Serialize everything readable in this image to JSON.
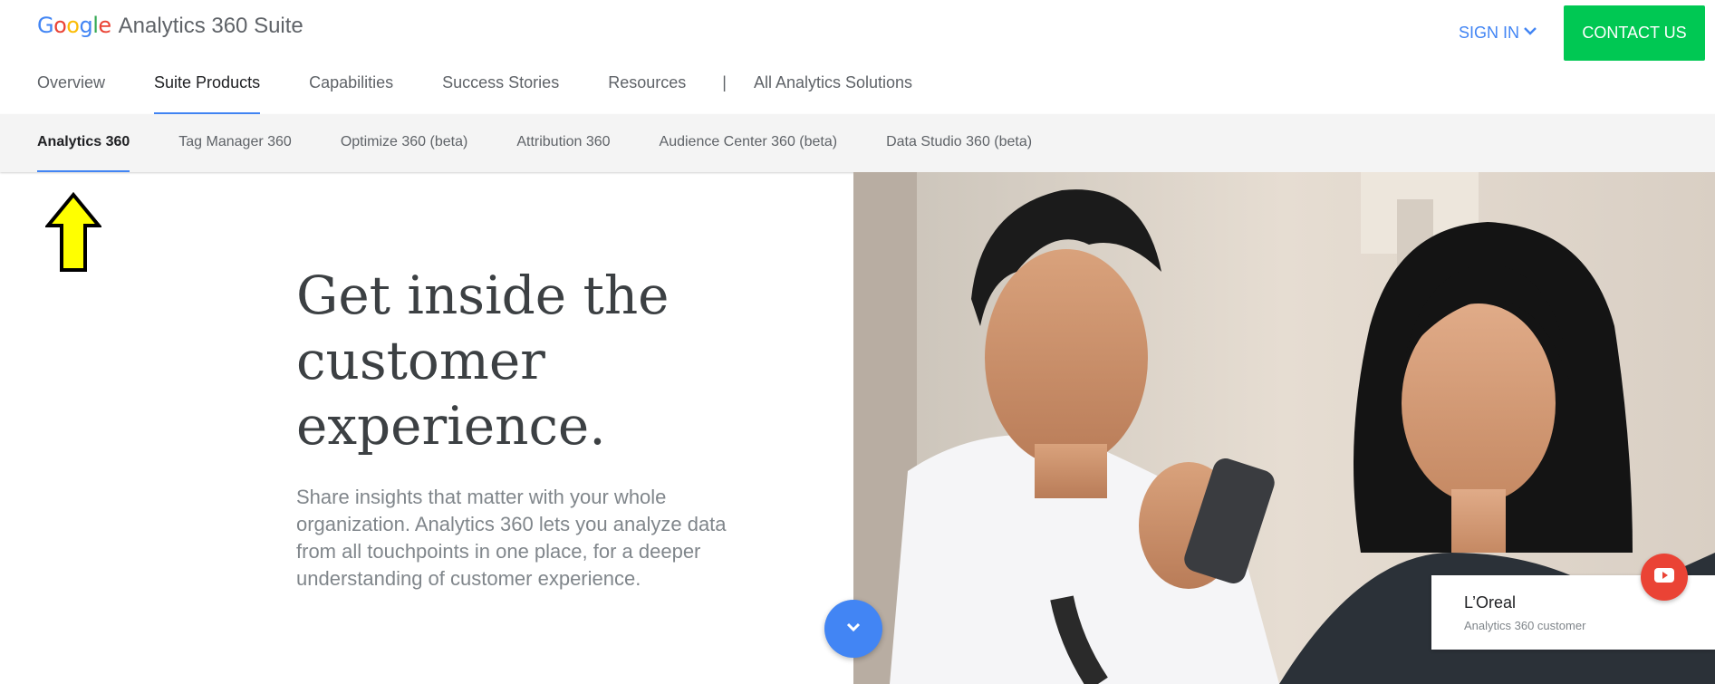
{
  "logo": {
    "google_letters": [
      "G",
      "o",
      "o",
      "g",
      "l",
      "e"
    ],
    "product": "Analytics 360 Suite"
  },
  "header": {
    "sign_in": "SIGN IN",
    "contact": "CONTACT US",
    "nav": [
      {
        "label": "Overview",
        "active": false
      },
      {
        "label": "Suite Products",
        "active": true
      },
      {
        "label": "Capabilities",
        "active": false
      },
      {
        "label": "Success Stories",
        "active": false
      },
      {
        "label": "Resources",
        "active": false
      },
      {
        "label": "All Analytics Solutions",
        "active": false
      }
    ],
    "separator": "|"
  },
  "sub_nav": [
    {
      "label": "Analytics 360",
      "active": true
    },
    {
      "label": "Tag Manager 360",
      "active": false
    },
    {
      "label": "Optimize 360 (beta)",
      "active": false
    },
    {
      "label": "Attribution 360",
      "active": false
    },
    {
      "label": "Audience Center 360 (beta)",
      "active": false
    },
    {
      "label": "Data Studio 360 (beta)",
      "active": false
    }
  ],
  "hero": {
    "headline_lines": [
      "Get inside the",
      "customer",
      "experience."
    ],
    "body": "Share insights that matter with your whole organization. Analytics 360 lets you analyze data from all touchpoints in one place, for a deeper understanding of customer experience."
  },
  "caption": {
    "name": "L’Oreal",
    "sub": "Analytics 360 customer"
  },
  "colors": {
    "accent": "#4285f4",
    "contact_bg": "#00c853",
    "play_bg": "#ea4335",
    "arrow": "#ffff00"
  },
  "icons": {
    "signin": "chevron-down-icon",
    "scroll": "chevron-down-icon",
    "play": "youtube-play-icon",
    "annotation": "up-arrow-icon"
  }
}
